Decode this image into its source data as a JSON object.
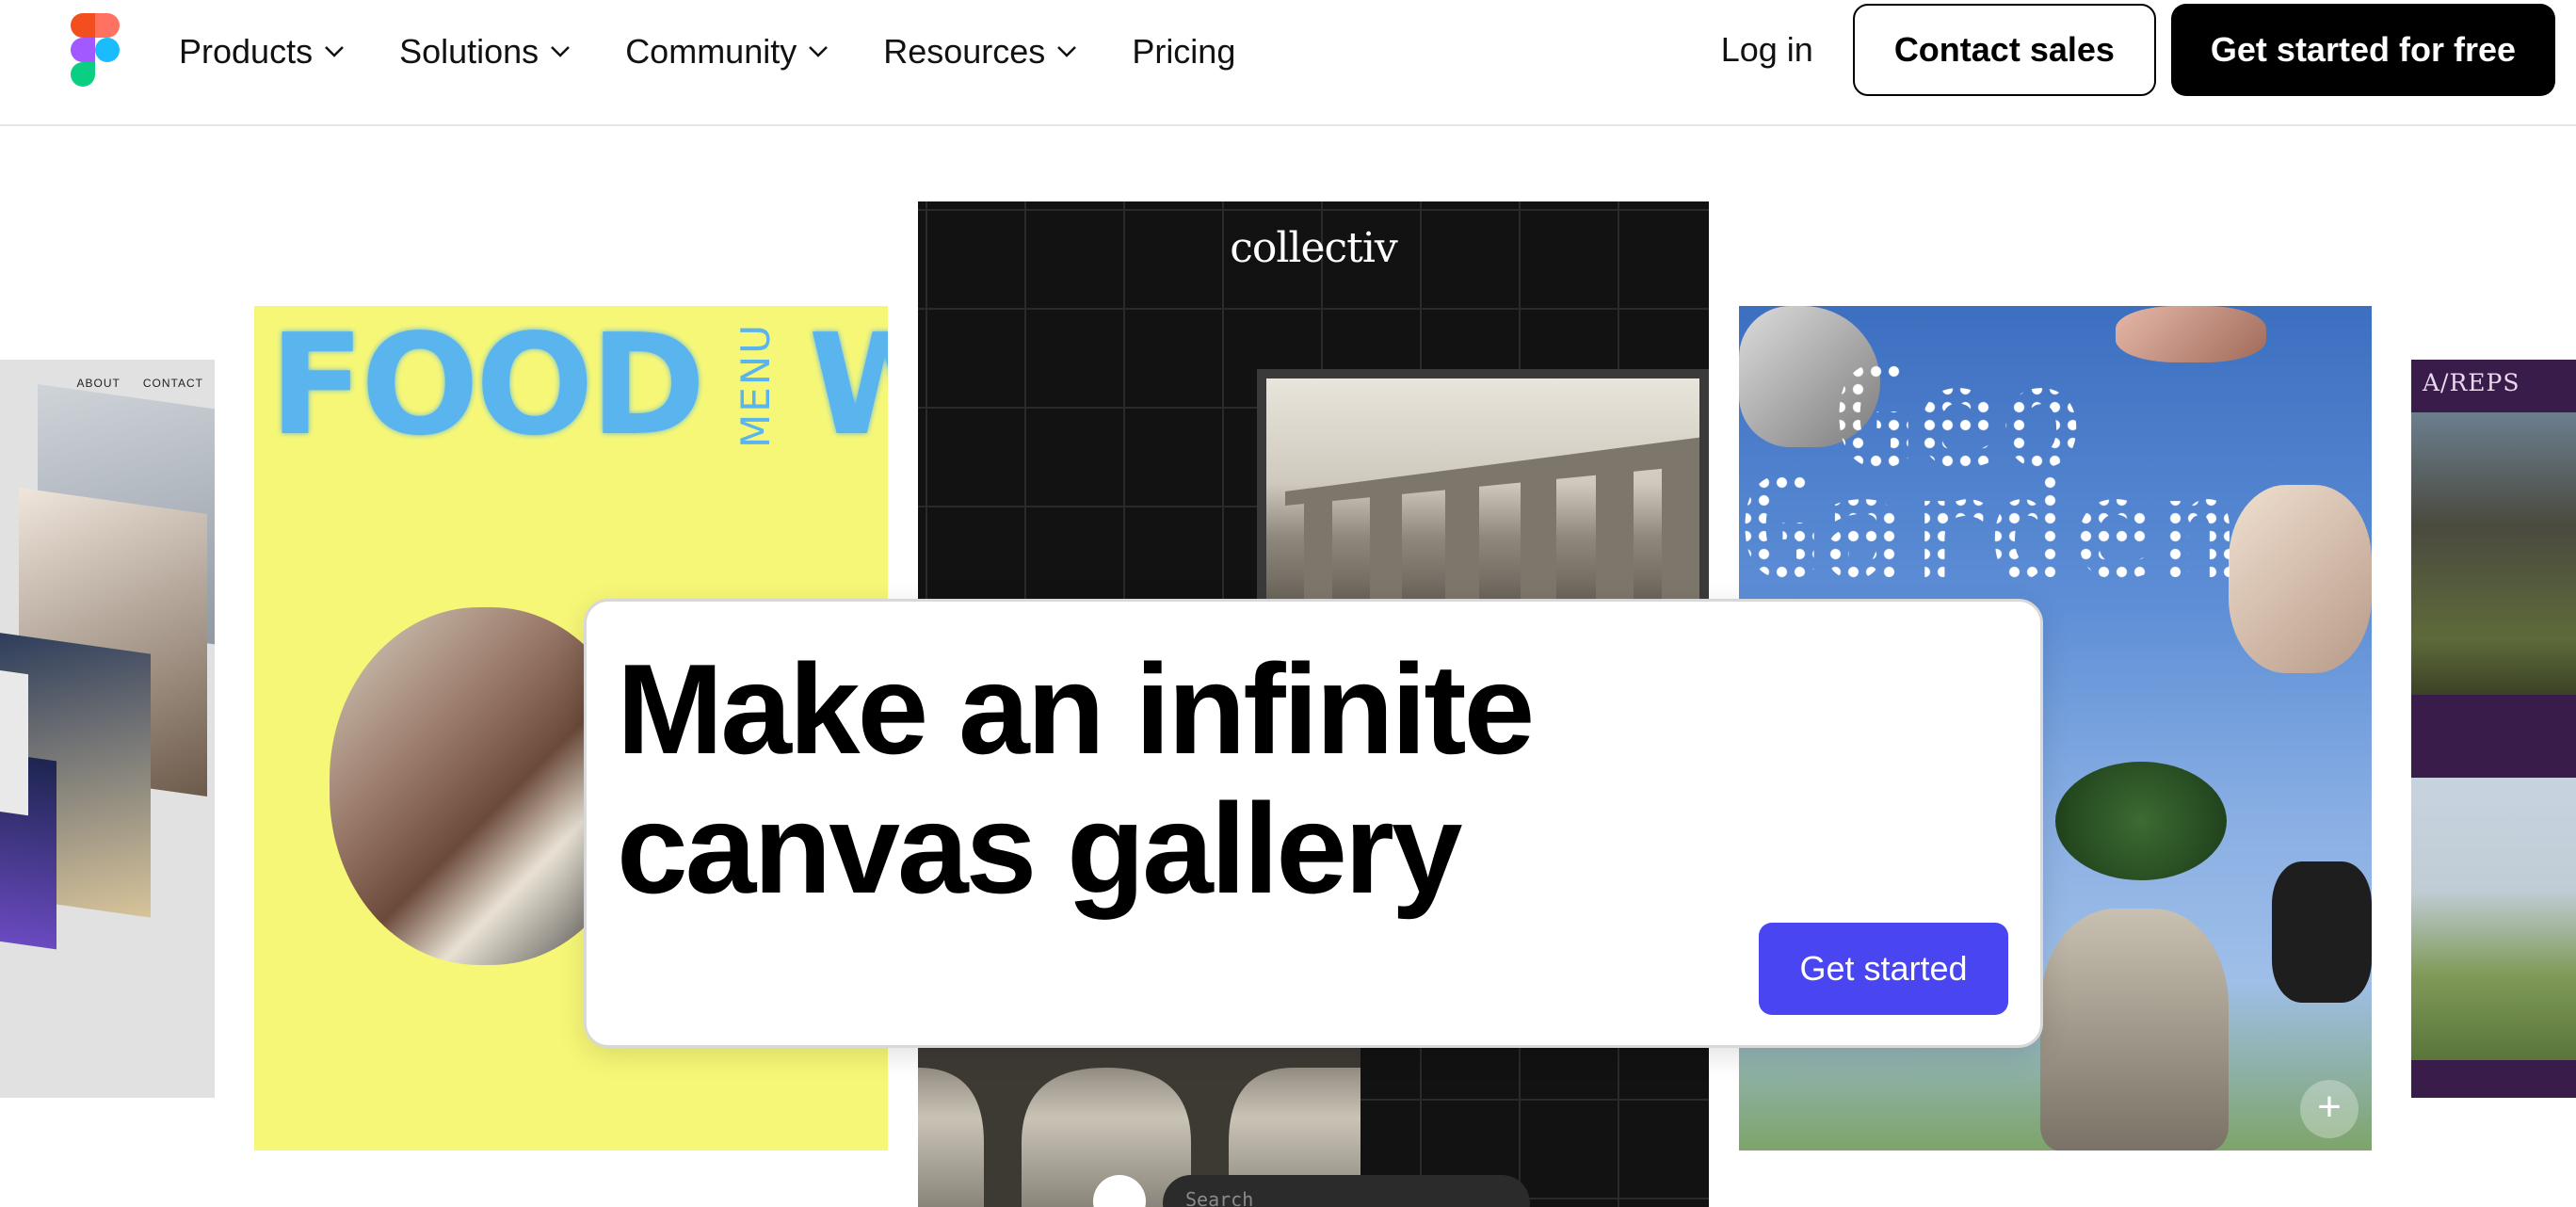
{
  "nav": {
    "items": [
      {
        "label": "Products",
        "has_dropdown": true
      },
      {
        "label": "Solutions",
        "has_dropdown": true
      },
      {
        "label": "Community",
        "has_dropdown": true
      },
      {
        "label": "Resources",
        "has_dropdown": true
      },
      {
        "label": "Pricing",
        "has_dropdown": false
      }
    ],
    "login_label": "Log in",
    "contact_label": "Contact sales",
    "get_started_label": "Get started for free",
    "logo_icon": "figma-logo-icon"
  },
  "gallery": {
    "left_card": {
      "nav": [
        "ABOUT",
        "CONTACT"
      ]
    },
    "food_card": {
      "word1": "FOOD",
      "menu": "MENU",
      "word2": "WORKS",
      "accent": "#5ab4ee",
      "background": "#f6f776"
    },
    "collectiv_card": {
      "logo": "collectiv",
      "search_placeholder": "Search"
    },
    "geo_card": {
      "line1": "Geo",
      "line2": "Garden"
    },
    "reps_card": {
      "label": "A/REPS"
    }
  },
  "hero": {
    "title": "Make an infinite canvas gallery",
    "button_label": "Get started",
    "button_color": "#4945f0"
  }
}
